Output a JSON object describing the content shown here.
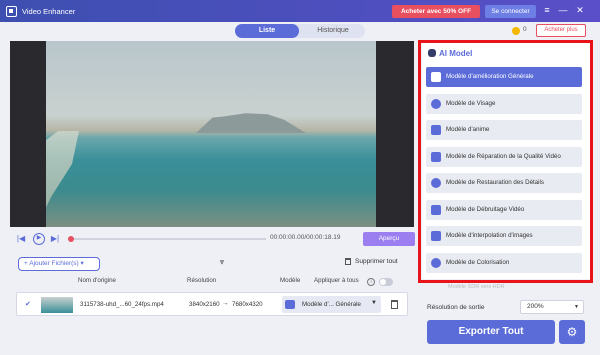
{
  "app": {
    "title": "Video Enhancer"
  },
  "header": {
    "promo": "Acheter avec 50% OFF",
    "connect": "Se connecter",
    "coins": "0",
    "buy_more": "Acheter plus",
    "tabs": [
      {
        "label": "Liste"
      },
      {
        "label": "Historique"
      }
    ]
  },
  "player": {
    "timecode": "00:00:00.00/00:00:18.19",
    "preview": "Aperçu",
    "progress": 0.0
  },
  "toolbar": {
    "add_files": "+ Ajouter Fichier(s) ▾",
    "delete_all": "Supprimer tout"
  },
  "table": {
    "headers": {
      "name": "Nom d'origine",
      "resolution": "Résolution",
      "model": "Modèle",
      "apply_all": "Appliquer à tous"
    },
    "rows": [
      {
        "name": "3115738-uhd_...60_24fps.mp4",
        "res_in": "3840x2160",
        "res_out": "7680x4320",
        "model": "Modèle d'... Générale"
      }
    ]
  },
  "ai_panel": {
    "title": "AI Model",
    "models": [
      {
        "label": "Modèle d'amélioration Générale",
        "icon": "enhance-icon",
        "active": true
      },
      {
        "label": "Modèle de Visage",
        "icon": "face-icon",
        "active": false
      },
      {
        "label": "Modèle d'anime",
        "icon": "anime-icon",
        "active": false
      },
      {
        "label": "Modèle de Réparation de la Qualité Vidéo",
        "icon": "repair-icon",
        "active": false
      },
      {
        "label": "Modèle de Restauration des Détails",
        "icon": "restore-icon",
        "active": false
      },
      {
        "label": "Modèle de Débruitage Vidéo",
        "icon": "denoise-icon",
        "active": false
      },
      {
        "label": "Modèle d'interpolation d'images",
        "icon": "interpolation-icon",
        "active": false
      },
      {
        "label": "Modèle de Colorisation",
        "icon": "colorize-icon",
        "active": false
      }
    ],
    "faded_next": "Modèle SDR vers HDR"
  },
  "output": {
    "label": "Résolution de sortie",
    "value": "200%",
    "export": "Exporter Tout"
  },
  "colors": {
    "accent": "#5b6cd9",
    "promo": "#e84f5f",
    "highlight": "#e8141a"
  }
}
